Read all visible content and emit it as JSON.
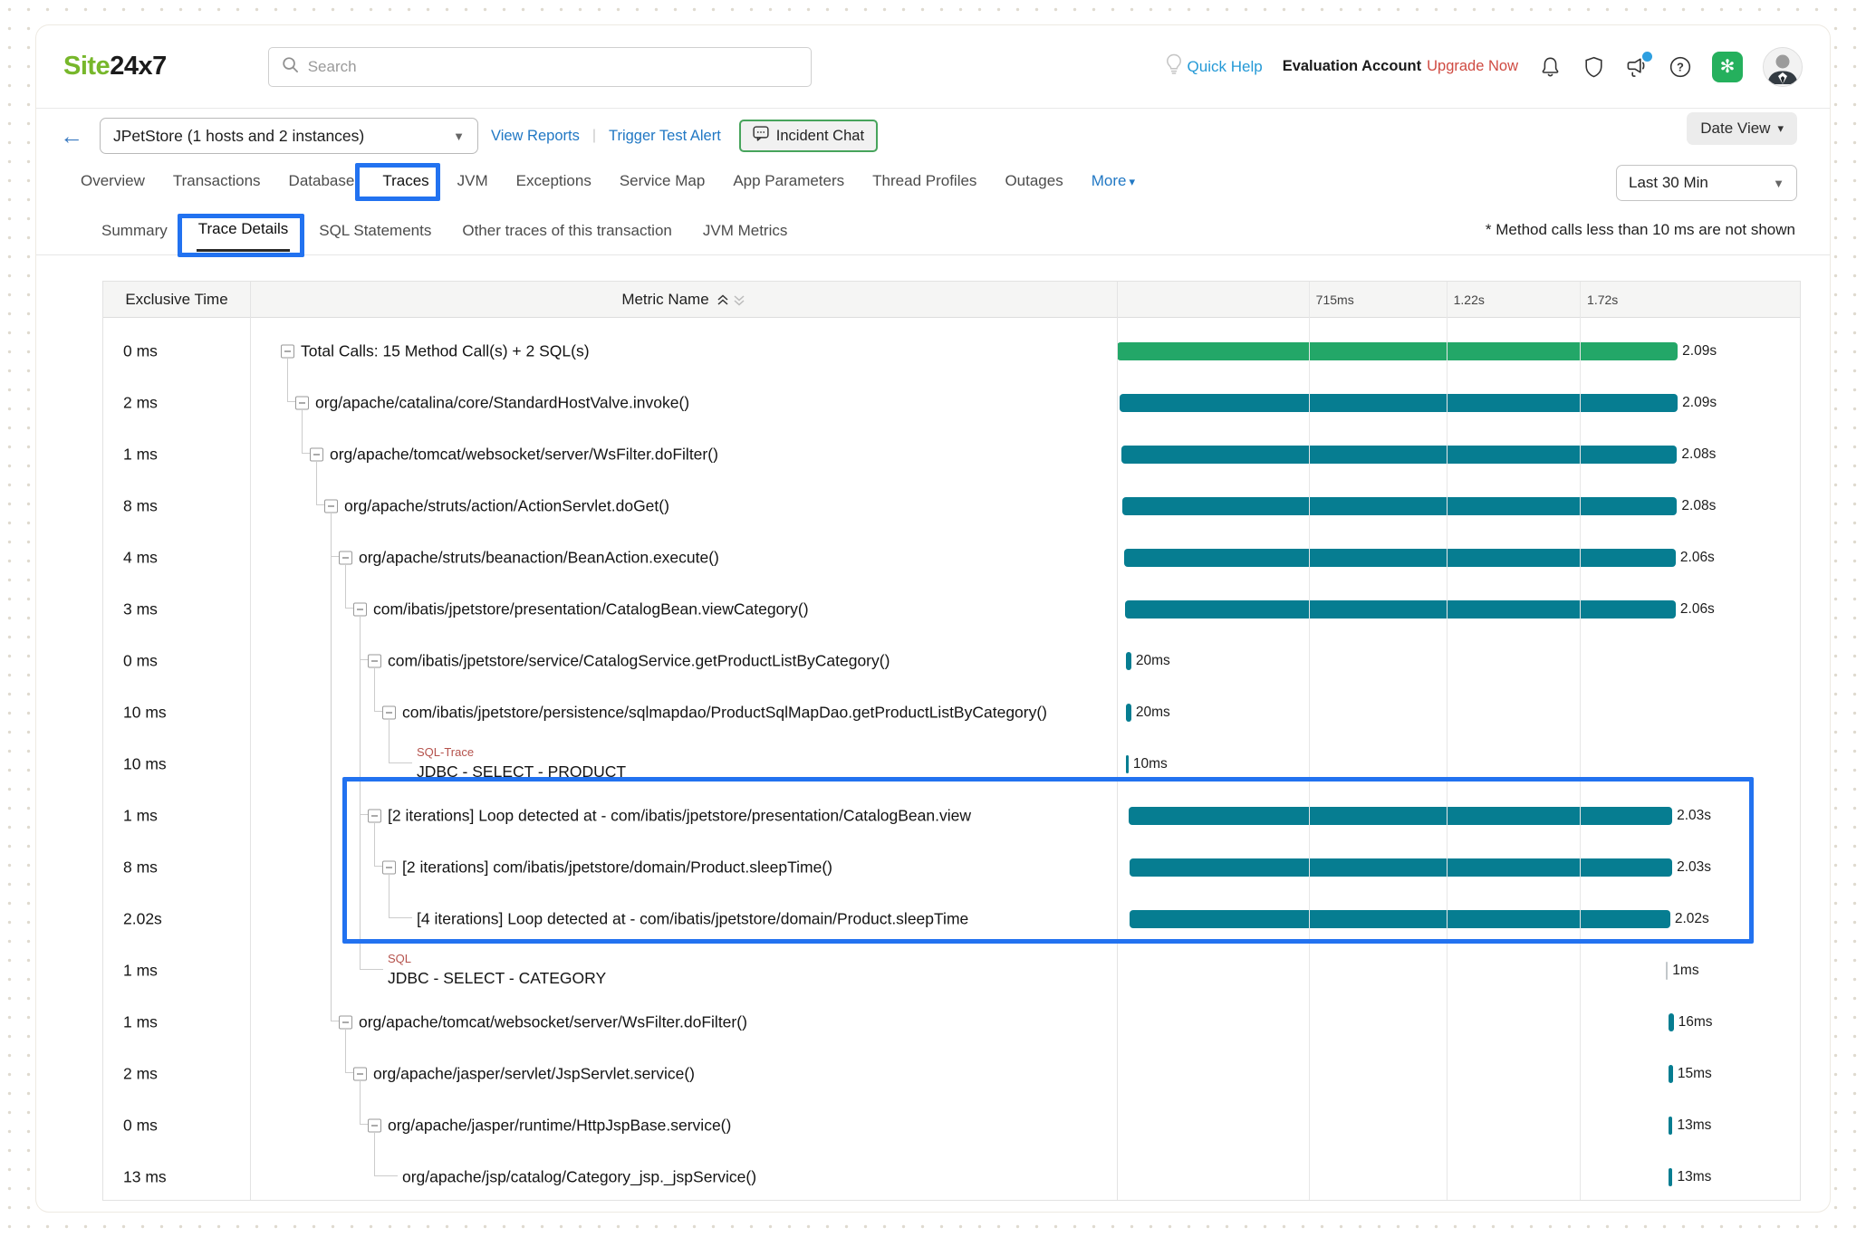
{
  "brand": {
    "part_green": "Site",
    "part_black": "24x7"
  },
  "header": {
    "search_placeholder": "Search",
    "quick_help": "Quick Help",
    "account_label": "Evaluation Account",
    "upgrade_label": "Upgrade Now"
  },
  "toolbar": {
    "app_selector_value": "JPetStore (1 hosts and 2 instances)",
    "view_reports": "View Reports",
    "trigger_test_alert": "Trigger Test Alert",
    "incident_chat": "Incident Chat",
    "date_view": "Date View"
  },
  "tabs": {
    "items": [
      "Overview",
      "Transactions",
      "Database",
      "Traces",
      "JVM",
      "Exceptions",
      "Service Map",
      "App Parameters",
      "Thread Profiles",
      "Outages"
    ],
    "active": "Traces",
    "more_label": "More"
  },
  "time_range_value": "Last 30 Min",
  "subtabs": {
    "items": [
      "Summary",
      "Trace Details",
      "SQL Statements",
      "Other traces of this transaction",
      "JVM Metrics"
    ],
    "active": "Trace Details"
  },
  "note": "* Method calls less than 10 ms are not shown",
  "table": {
    "col_exclusive": "Exclusive Time",
    "col_metric": "Metric Name",
    "axis": [
      {
        "label": "715ms",
        "frac": 0.28
      },
      {
        "label": "1.22s",
        "frac": 0.481
      },
      {
        "label": "1.72s",
        "frac": 0.676
      }
    ],
    "rows": [
      {
        "t": "0 ms",
        "label": "Total Calls: 15 Method Call(s) + 2 SQL(s)",
        "level": 0,
        "kind": "expand",
        "tag": null,
        "bar": {
          "left": 0.0,
          "width": 0.819,
          "color": "green",
          "label": "2.09s"
        }
      },
      {
        "t": "2 ms",
        "label": "org/apache/catalina/core/StandardHostValve.invoke()",
        "level": 1,
        "kind": "expand",
        "tag": null,
        "bar": {
          "left": 0.004,
          "width": 0.815,
          "color": "teal",
          "label": "2.09s"
        }
      },
      {
        "t": "1 ms",
        "label": "org/apache/tomcat/websocket/server/WsFilter.doFilter()",
        "level": 2,
        "kind": "expand",
        "tag": null,
        "bar": {
          "left": 0.006,
          "width": 0.812,
          "color": "teal",
          "label": "2.08s"
        }
      },
      {
        "t": "8 ms",
        "label": "org/apache/struts/action/ActionServlet.doGet()",
        "level": 3,
        "kind": "expand",
        "tag": null,
        "bar": {
          "left": 0.008,
          "width": 0.81,
          "color": "teal",
          "label": "2.08s"
        }
      },
      {
        "t": "4 ms",
        "label": "org/apache/struts/beanaction/BeanAction.execute()",
        "level": 4,
        "kind": "expand",
        "tag": null,
        "bar": {
          "left": 0.01,
          "width": 0.806,
          "color": "teal",
          "label": "2.06s"
        }
      },
      {
        "t": "3 ms",
        "label": "com/ibatis/jpetstore/presentation/CatalogBean.viewCategory()",
        "level": 5,
        "kind": "expand",
        "tag": null,
        "bar": {
          "left": 0.012,
          "width": 0.804,
          "color": "teal",
          "label": "2.06s"
        }
      },
      {
        "t": "0 ms",
        "label": "com/ibatis/jpetstore/service/CatalogService.getProductListByCategory()",
        "level": 6,
        "kind": "expand",
        "tag": null,
        "bar": {
          "left": 0.013,
          "width": 0.008,
          "color": "teal",
          "label": "20ms"
        }
      },
      {
        "t": "10 ms",
        "label": "com/ibatis/jpetstore/persistence/sqlmapdao/ProductSqlMapDao.getProductListByCategory()",
        "level": 7,
        "kind": "expand",
        "tag": null,
        "bar": {
          "left": 0.013,
          "width": 0.008,
          "color": "teal",
          "label": "20ms"
        }
      },
      {
        "t": "10 ms",
        "label": "JDBC - SELECT - PRODUCT",
        "level": 8,
        "kind": "leaf",
        "tag": "SQL-Trace",
        "bar": {
          "left": 0.013,
          "width": 0.004,
          "color": "teal",
          "label": "10ms"
        }
      },
      {
        "t": "1 ms",
        "label": "[2 iterations] Loop detected at - com/ibatis/jpetstore/presentation/CatalogBean.view",
        "level": 6,
        "kind": "expand",
        "tag": null,
        "bar": {
          "left": 0.017,
          "width": 0.794,
          "color": "teal",
          "label": "2.03s"
        }
      },
      {
        "t": "8 ms",
        "label": "[2 iterations] com/ibatis/jpetstore/domain/Product.sleepTime()",
        "level": 7,
        "kind": "expand",
        "tag": null,
        "bar": {
          "left": 0.019,
          "width": 0.792,
          "color": "teal",
          "label": "2.03s"
        }
      },
      {
        "t": "2.02s",
        "label": "[4 iterations] Loop detected at - com/ibatis/jpetstore/domain/Product.sleepTime",
        "level": 8,
        "kind": "leaf",
        "tag": null,
        "bar": {
          "left": 0.019,
          "width": 0.789,
          "color": "teal",
          "label": "2.02s"
        }
      },
      {
        "t": "1 ms",
        "label": "JDBC - SELECT - CATEGORY",
        "level": 6,
        "kind": "leaf",
        "tag": "SQL",
        "bar": {
          "left": 0.802,
          "width": 0.002,
          "color": "muted",
          "label": "1ms"
        }
      },
      {
        "t": "1 ms",
        "label": "org/apache/tomcat/websocket/server/WsFilter.doFilter()",
        "level": 4,
        "kind": "expand",
        "tag": null,
        "bar": {
          "left": 0.806,
          "width": 0.007,
          "color": "teal",
          "label": "16ms"
        }
      },
      {
        "t": "2 ms",
        "label": "org/apache/jasper/servlet/JspServlet.service()",
        "level": 5,
        "kind": "expand",
        "tag": null,
        "bar": {
          "left": 0.806,
          "width": 0.006,
          "color": "teal",
          "label": "15ms"
        }
      },
      {
        "t": "0 ms",
        "label": "org/apache/jasper/runtime/HttpJspBase.service()",
        "level": 6,
        "kind": "expand",
        "tag": null,
        "bar": {
          "left": 0.806,
          "width": 0.0055,
          "color": "teal",
          "label": "13ms"
        }
      },
      {
        "t": "13 ms",
        "label": "org/apache/jsp/catalog/Category_jsp._jspService()",
        "level": 7,
        "kind": "leaf",
        "tag": null,
        "bar": {
          "left": 0.806,
          "width": 0.0055,
          "color": "teal",
          "label": "13ms"
        }
      }
    ]
  },
  "colors": {
    "bar_green": "#23a768",
    "bar_teal": "#067d91",
    "annotation_blue": "#2272f0",
    "brand_green": "#77b72b",
    "link_blue": "#2178c4",
    "upgrade_red": "#cf4a41"
  }
}
